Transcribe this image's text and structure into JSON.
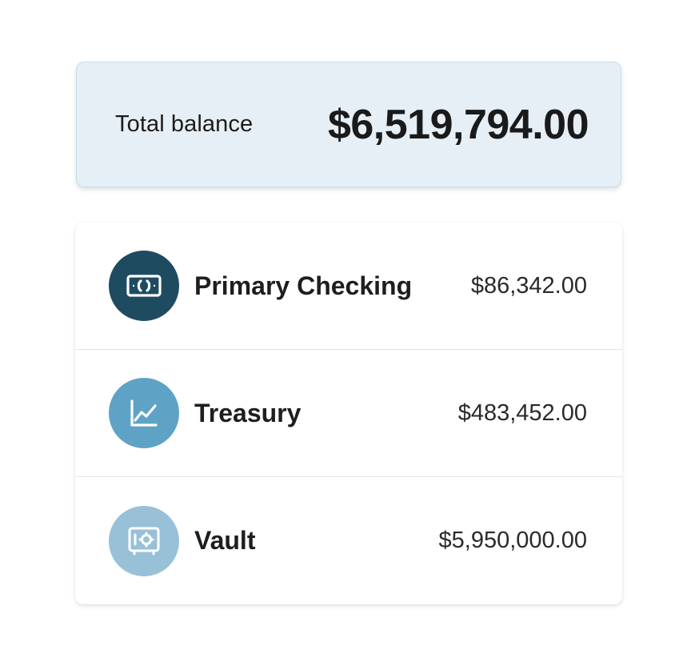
{
  "summary": {
    "label": "Total balance",
    "amount": "$6,519,794.00"
  },
  "accounts": [
    {
      "name": "Primary Checking",
      "balance": "$86,342.00",
      "icon": "banknote-icon",
      "color": "#1f4b61"
    },
    {
      "name": "Treasury",
      "balance": "$483,452.00",
      "icon": "line-chart-icon",
      "color": "#5ea3c6"
    },
    {
      "name": "Vault",
      "balance": "$5,950,000.00",
      "icon": "safe-icon",
      "color": "#98c1d8"
    }
  ],
  "colors": {
    "summary_background": "#e6eff5",
    "summary_border": "#c9dde9"
  }
}
